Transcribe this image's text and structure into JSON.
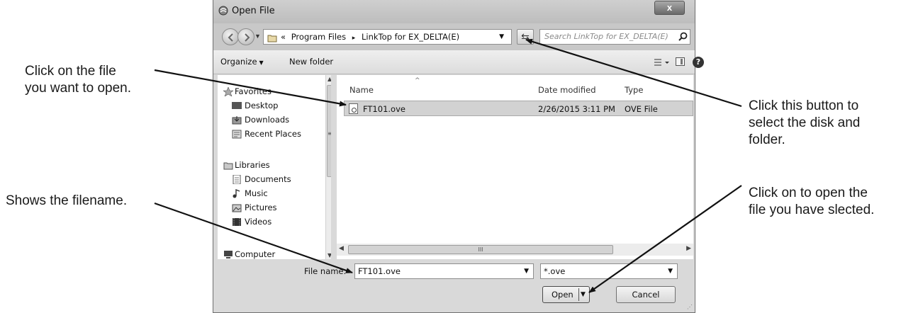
{
  "callouts": {
    "file_click_line1": "Click on the file",
    "file_click_line2": "you want to open.",
    "filename": "Shows the filename.",
    "disk_line1": "Click this button to",
    "disk_line2": "select the disk and",
    "disk_line3": "folder.",
    "open_line1": "Click on to open the",
    "open_line2": "file you have slected."
  },
  "window": {
    "title": "Open File",
    "close_label": "x"
  },
  "navbar": {
    "overflow": "«",
    "crumbs": [
      "Program Files",
      "LinkTop for EX_DELTA(E)"
    ],
    "separator": "▸",
    "search_placeholder": "Search LinkTop for EX_DELTA(E)"
  },
  "toolbar": {
    "organize": "Organize",
    "new_folder": "New folder",
    "help": "?"
  },
  "navpane": {
    "favorites": "Favorites",
    "desktop": "Desktop",
    "downloads": "Downloads",
    "recent": "Recent Places",
    "libraries": "Libraries",
    "documents": "Documents",
    "music": "Music",
    "pictures": "Pictures",
    "videos": "Videos",
    "computer": "Computer"
  },
  "filelist": {
    "columns": {
      "name": "Name",
      "date": "Date modified",
      "type": "Type"
    },
    "rows": [
      {
        "name": "FT101.ove",
        "date": "2/26/2015 3:11 PM",
        "type": "OVE File"
      }
    ],
    "scroll_grip": "III"
  },
  "bottom": {
    "filename_label": "File name:",
    "filename_value": "FT101.ove",
    "filetype_value": "*.ove",
    "open_label": "Open",
    "cancel_label": "Cancel"
  },
  "colors": {
    "window_bg": "#d9d9d9",
    "selection": "#d2d2d2",
    "arrow": "#111111"
  }
}
